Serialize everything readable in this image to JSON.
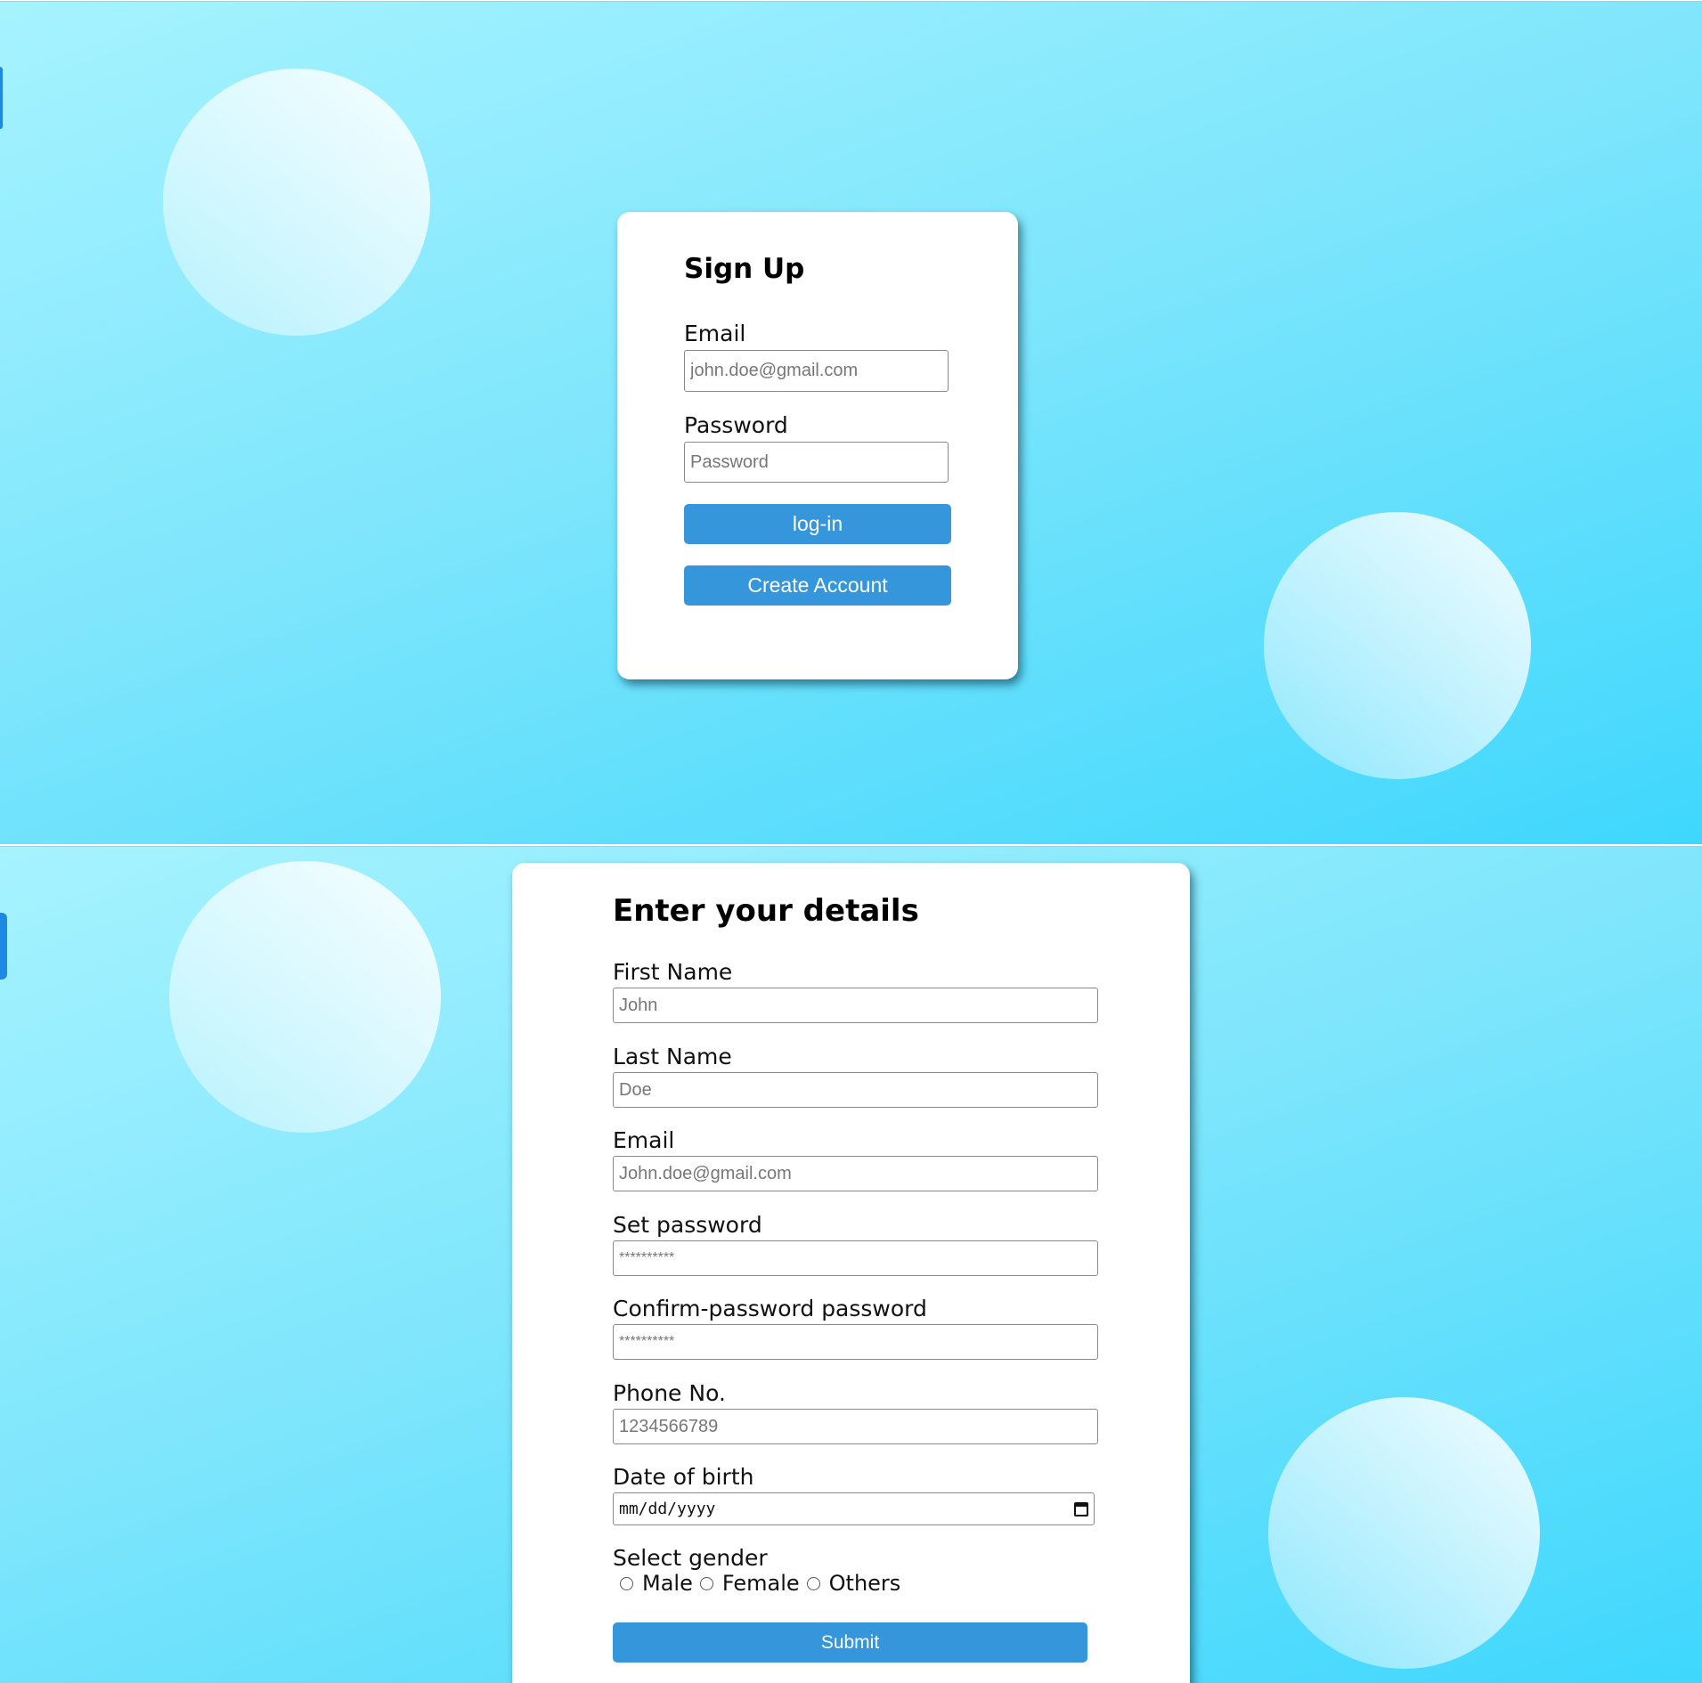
{
  "login": {
    "title": "Sign Up",
    "email_label": "Email",
    "email_placeholder": "john.doe@gmail.com",
    "password_label": "Password",
    "password_placeholder": "Password",
    "login_button": "log-in",
    "create_account_button": "Create Account"
  },
  "details": {
    "title": "Enter your details",
    "first_name_label": "First Name",
    "first_name_placeholder": "John",
    "last_name_label": "Last Name",
    "last_name_placeholder": "Doe",
    "email_label": "Email",
    "email_placeholder": "John.doe@gmail.com",
    "set_password_label": "Set password",
    "set_password_placeholder": "**********",
    "confirm_password_label": "Confirm-password password",
    "confirm_password_placeholder": "**********",
    "phone_label": "Phone No.",
    "phone_placeholder": "1234566789",
    "dob_label": "Date of birth",
    "dob_placeholder": "mm/dd/yyyy",
    "gender_label": "Select gender",
    "gender_options": [
      "Male",
      "Female",
      "Others"
    ],
    "submit_button": "Submit"
  },
  "colors": {
    "background_start": "#a6f3ff",
    "background_end": "#3fd7fd",
    "button": "#3696dc",
    "card": "#ffffff"
  }
}
